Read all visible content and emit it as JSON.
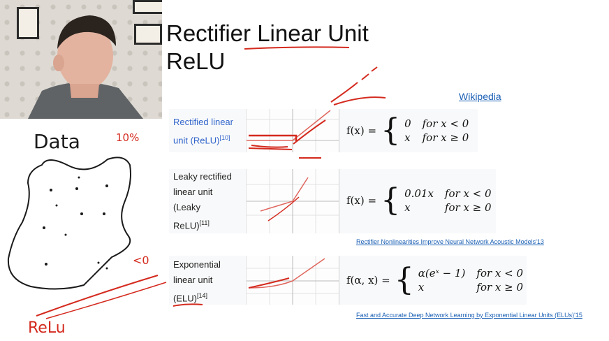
{
  "slide": {
    "title_line1": "Rectifier Linear Unit",
    "title_line2": "ReLU",
    "wikipedia_link": "Wikipedia"
  },
  "rows": [
    {
      "name_parts": [
        "Rectified linear",
        "unit (ReLU)"
      ],
      "ref": "[10]",
      "lhs": "f(x) =",
      "case1_value": "0",
      "case1_cond": "for x < 0",
      "case2_value": "x",
      "case2_cond": "for x ≥ 0"
    },
    {
      "name_parts": [
        "Leaky rectified",
        "linear unit",
        "(Leaky",
        "ReLU)"
      ],
      "ref": "[11]",
      "lhs": "f(x) =",
      "case1_value": "0.01x",
      "case1_cond": "for x < 0",
      "case2_value": "x",
      "case2_cond": "for x ≥ 0"
    },
    {
      "name_parts": [
        "Exponential",
        "linear unit",
        "(ELU)"
      ],
      "ref": "[14]",
      "lhs": "f(α, x) =",
      "case1_value": "α(eˣ − 1)",
      "case1_cond": "for x < 0",
      "case2_value": "x",
      "case2_cond": "for x ≥ 0"
    }
  ],
  "paper_links": {
    "leaky": "Rectifier Nonlinearities Improve Neural Network Acoustic Models'13",
    "elu": "Fast and Accurate Deep Network Learning by Exponential Linear Units (ELUs)'15"
  },
  "handwriting": {
    "data_label": "Data",
    "percent_note": "10%",
    "less_than_note": "<0",
    "relu_label": "ReLu"
  },
  "colors": {
    "ink_red": "#d42a1e",
    "ink_black": "#1a1a1a",
    "link_blue": "#1a5fb4",
    "name_blue": "#3366cc"
  }
}
